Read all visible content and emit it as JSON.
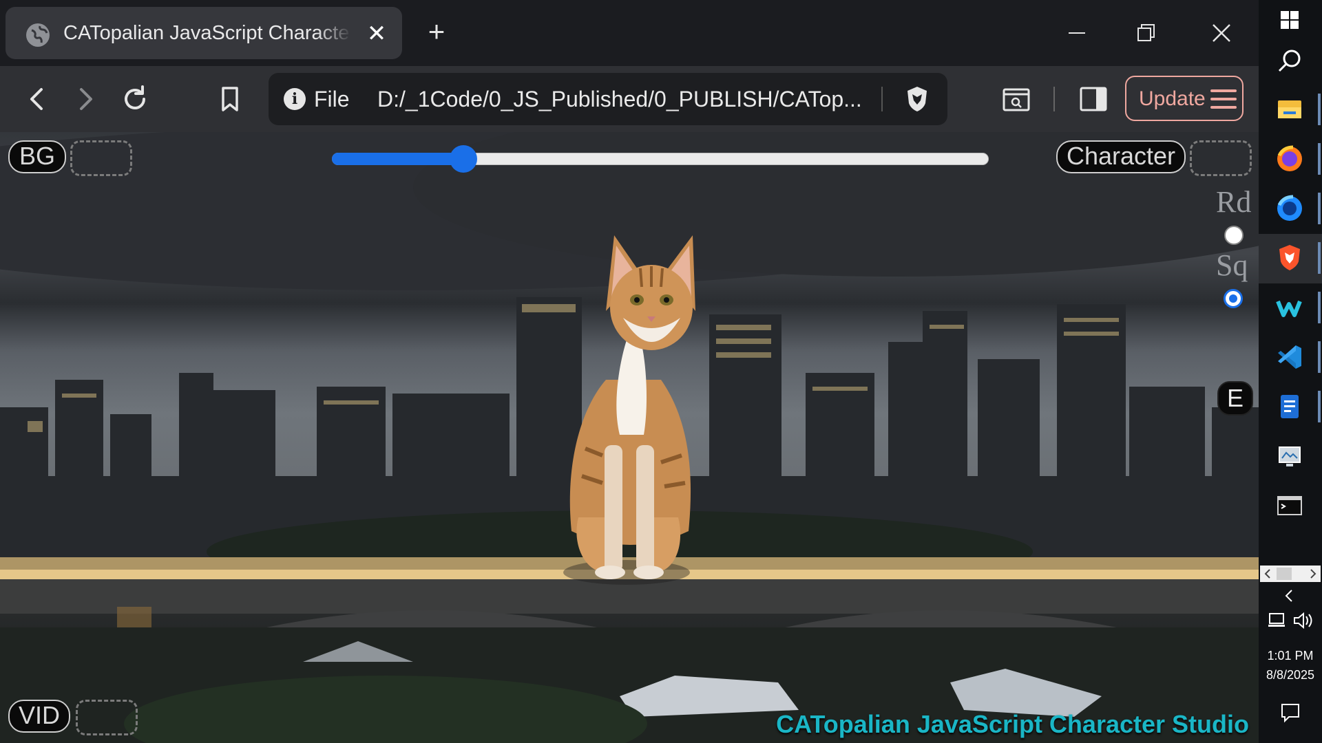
{
  "browser": {
    "tab_title": "CATopalian JavaScript Character Studio",
    "tab_close": "✕",
    "new_tab": "+",
    "file_label": "File",
    "url": "D:/_1Code/0_JS_Published/0_PUBLISH/CATop...",
    "update_label": "Update"
  },
  "page": {
    "bg_label": "BG",
    "character_label": "Character",
    "vid_label": "VID",
    "slider_value_fraction": 0.2,
    "shape_labels": {
      "round": "Rd",
      "square": "Sq"
    },
    "shape_selected": "Sq",
    "e_label": "E",
    "studio_title": "CATopalian JavaScript Character Studio"
  },
  "taskbar": {
    "time": "1:01 PM",
    "date": "8/8/2025",
    "icons": [
      "windows-start-icon",
      "search-icon",
      "file-explorer-icon",
      "firefox-icon",
      "firefox-dev-icon",
      "brave-icon",
      "windsurf-icon",
      "vscode-icon",
      "notepad-icon",
      "monitor-app-icon",
      "terminal-icon"
    ]
  }
}
